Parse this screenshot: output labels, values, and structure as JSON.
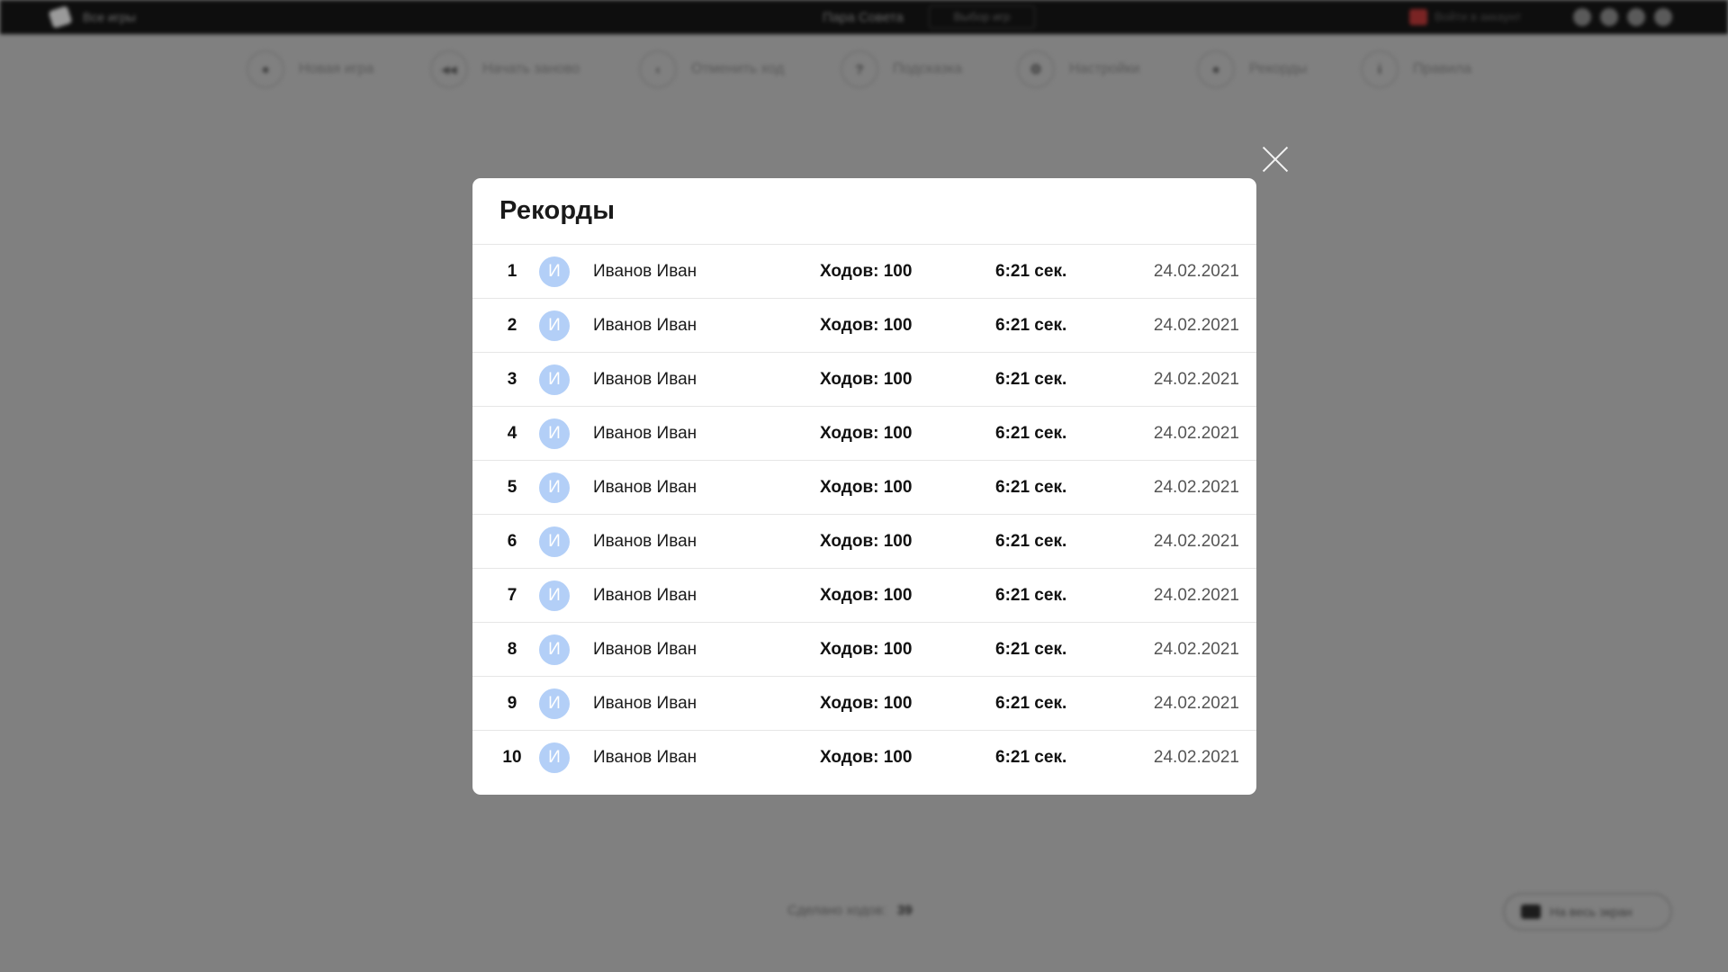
{
  "topbar": {
    "brand": "Все игры",
    "game_title": "Пара Совета",
    "choose_button": "Выбор игр",
    "user_link": "Войти в аккаунт",
    "circle_icons": [
      "vk-icon",
      "ok-icon",
      "fb-icon",
      "tw-icon"
    ]
  },
  "toolbar": [
    {
      "icon": "play-icon",
      "glyph": "●",
      "label": "Новая игра"
    },
    {
      "icon": "restart-icon",
      "glyph": "◀◀",
      "label": "Начать заново"
    },
    {
      "icon": "undo-icon",
      "glyph": "‹",
      "label": "Отменить ход"
    },
    {
      "icon": "hint-icon",
      "glyph": "?",
      "label": "Подсказка"
    },
    {
      "icon": "settings-icon",
      "glyph": "⚙",
      "label": "Настройки"
    },
    {
      "icon": "records-icon",
      "glyph": "●",
      "label": "Рекорды"
    },
    {
      "icon": "rules-icon",
      "glyph": "i",
      "label": "Правила"
    }
  ],
  "footer": {
    "moves_label": "Сделано ходов:",
    "moves_value": "39",
    "fullscreen_label": "На весь экран"
  },
  "modal": {
    "title": "Рекорды",
    "close_icon": "close-icon",
    "avatar_color": "#b3cff7",
    "records": [
      {
        "rank": "1",
        "avatar": "И",
        "name": "Иванов Иван",
        "moves": "Ходов: 100",
        "time": "6:21 сек.",
        "date": "24.02.2021"
      },
      {
        "rank": "2",
        "avatar": "И",
        "name": "Иванов Иван",
        "moves": "Ходов: 100",
        "time": "6:21 сек.",
        "date": "24.02.2021"
      },
      {
        "rank": "3",
        "avatar": "И",
        "name": "Иванов Иван",
        "moves": "Ходов: 100",
        "time": "6:21 сек.",
        "date": "24.02.2021"
      },
      {
        "rank": "4",
        "avatar": "И",
        "name": "Иванов Иван",
        "moves": "Ходов: 100",
        "time": "6:21 сек.",
        "date": "24.02.2021"
      },
      {
        "rank": "5",
        "avatar": "И",
        "name": "Иванов Иван",
        "moves": "Ходов: 100",
        "time": "6:21 сек.",
        "date": "24.02.2021"
      },
      {
        "rank": "6",
        "avatar": "И",
        "name": "Иванов Иван",
        "moves": "Ходов: 100",
        "time": "6:21 сек.",
        "date": "24.02.2021"
      },
      {
        "rank": "7",
        "avatar": "И",
        "name": "Иванов Иван",
        "moves": "Ходов: 100",
        "time": "6:21 сек.",
        "date": "24.02.2021"
      },
      {
        "rank": "8",
        "avatar": "И",
        "name": "Иванов Иван",
        "moves": "Ходов: 100",
        "time": "6:21 сек.",
        "date": "24.02.2021"
      },
      {
        "rank": "9",
        "avatar": "И",
        "name": "Иванов Иван",
        "moves": "Ходов: 100",
        "time": "6:21 сек.",
        "date": "24.02.2021"
      },
      {
        "rank": "10",
        "avatar": "И",
        "name": "Иванов Иван",
        "moves": "Ходов: 100",
        "time": "6:21 сек.",
        "date": "24.02.2021"
      }
    ]
  }
}
